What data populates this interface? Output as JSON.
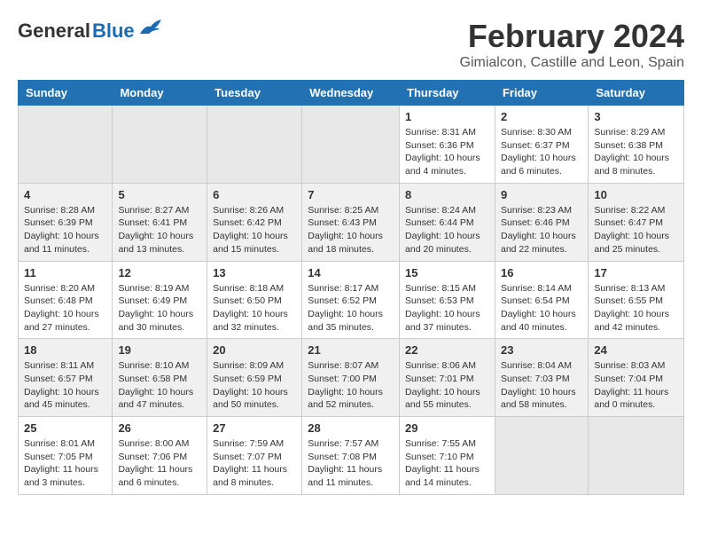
{
  "header": {
    "logo_general": "General",
    "logo_blue": "Blue",
    "title": "February 2024",
    "subtitle": "Gimialcon, Castille and Leon, Spain"
  },
  "weekdays": [
    "Sunday",
    "Monday",
    "Tuesday",
    "Wednesday",
    "Thursday",
    "Friday",
    "Saturday"
  ],
  "weeks": [
    [
      {
        "day": "",
        "info": ""
      },
      {
        "day": "",
        "info": ""
      },
      {
        "day": "",
        "info": ""
      },
      {
        "day": "",
        "info": ""
      },
      {
        "day": "1",
        "info": "Sunrise: 8:31 AM\nSunset: 6:36 PM\nDaylight: 10 hours\nand 4 minutes."
      },
      {
        "day": "2",
        "info": "Sunrise: 8:30 AM\nSunset: 6:37 PM\nDaylight: 10 hours\nand 6 minutes."
      },
      {
        "day": "3",
        "info": "Sunrise: 8:29 AM\nSunset: 6:38 PM\nDaylight: 10 hours\nand 8 minutes."
      }
    ],
    [
      {
        "day": "4",
        "info": "Sunrise: 8:28 AM\nSunset: 6:39 PM\nDaylight: 10 hours\nand 11 minutes."
      },
      {
        "day": "5",
        "info": "Sunrise: 8:27 AM\nSunset: 6:41 PM\nDaylight: 10 hours\nand 13 minutes."
      },
      {
        "day": "6",
        "info": "Sunrise: 8:26 AM\nSunset: 6:42 PM\nDaylight: 10 hours\nand 15 minutes."
      },
      {
        "day": "7",
        "info": "Sunrise: 8:25 AM\nSunset: 6:43 PM\nDaylight: 10 hours\nand 18 minutes."
      },
      {
        "day": "8",
        "info": "Sunrise: 8:24 AM\nSunset: 6:44 PM\nDaylight: 10 hours\nand 20 minutes."
      },
      {
        "day": "9",
        "info": "Sunrise: 8:23 AM\nSunset: 6:46 PM\nDaylight: 10 hours\nand 22 minutes."
      },
      {
        "day": "10",
        "info": "Sunrise: 8:22 AM\nSunset: 6:47 PM\nDaylight: 10 hours\nand 25 minutes."
      }
    ],
    [
      {
        "day": "11",
        "info": "Sunrise: 8:20 AM\nSunset: 6:48 PM\nDaylight: 10 hours\nand 27 minutes."
      },
      {
        "day": "12",
        "info": "Sunrise: 8:19 AM\nSunset: 6:49 PM\nDaylight: 10 hours\nand 30 minutes."
      },
      {
        "day": "13",
        "info": "Sunrise: 8:18 AM\nSunset: 6:50 PM\nDaylight: 10 hours\nand 32 minutes."
      },
      {
        "day": "14",
        "info": "Sunrise: 8:17 AM\nSunset: 6:52 PM\nDaylight: 10 hours\nand 35 minutes."
      },
      {
        "day": "15",
        "info": "Sunrise: 8:15 AM\nSunset: 6:53 PM\nDaylight: 10 hours\nand 37 minutes."
      },
      {
        "day": "16",
        "info": "Sunrise: 8:14 AM\nSunset: 6:54 PM\nDaylight: 10 hours\nand 40 minutes."
      },
      {
        "day": "17",
        "info": "Sunrise: 8:13 AM\nSunset: 6:55 PM\nDaylight: 10 hours\nand 42 minutes."
      }
    ],
    [
      {
        "day": "18",
        "info": "Sunrise: 8:11 AM\nSunset: 6:57 PM\nDaylight: 10 hours\nand 45 minutes."
      },
      {
        "day": "19",
        "info": "Sunrise: 8:10 AM\nSunset: 6:58 PM\nDaylight: 10 hours\nand 47 minutes."
      },
      {
        "day": "20",
        "info": "Sunrise: 8:09 AM\nSunset: 6:59 PM\nDaylight: 10 hours\nand 50 minutes."
      },
      {
        "day": "21",
        "info": "Sunrise: 8:07 AM\nSunset: 7:00 PM\nDaylight: 10 hours\nand 52 minutes."
      },
      {
        "day": "22",
        "info": "Sunrise: 8:06 AM\nSunset: 7:01 PM\nDaylight: 10 hours\nand 55 minutes."
      },
      {
        "day": "23",
        "info": "Sunrise: 8:04 AM\nSunset: 7:03 PM\nDaylight: 10 hours\nand 58 minutes."
      },
      {
        "day": "24",
        "info": "Sunrise: 8:03 AM\nSunset: 7:04 PM\nDaylight: 11 hours\nand 0 minutes."
      }
    ],
    [
      {
        "day": "25",
        "info": "Sunrise: 8:01 AM\nSunset: 7:05 PM\nDaylight: 11 hours\nand 3 minutes."
      },
      {
        "day": "26",
        "info": "Sunrise: 8:00 AM\nSunset: 7:06 PM\nDaylight: 11 hours\nand 6 minutes."
      },
      {
        "day": "27",
        "info": "Sunrise: 7:59 AM\nSunset: 7:07 PM\nDaylight: 11 hours\nand 8 minutes."
      },
      {
        "day": "28",
        "info": "Sunrise: 7:57 AM\nSunset: 7:08 PM\nDaylight: 11 hours\nand 11 minutes."
      },
      {
        "day": "29",
        "info": "Sunrise: 7:55 AM\nSunset: 7:10 PM\nDaylight: 11 hours\nand 14 minutes."
      },
      {
        "day": "",
        "info": ""
      },
      {
        "day": "",
        "info": ""
      }
    ]
  ]
}
